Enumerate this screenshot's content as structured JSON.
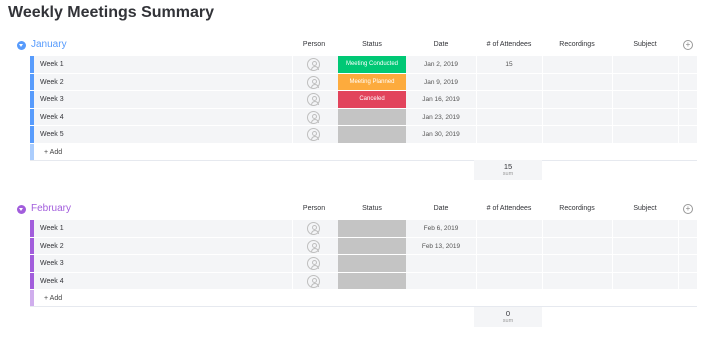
{
  "page_title": "Weekly Meetings Summary",
  "columns": {
    "person": "Person",
    "status": "Status",
    "date": "Date",
    "attendees": "# of Attendees",
    "recordings": "Recordings",
    "subject": "Subject"
  },
  "add_item_label": "+ Add",
  "sum_caption": "sum",
  "colors": {
    "january": "#579bfc",
    "february": "#a25ddc",
    "meeting_conducted": "#00c875",
    "meeting_planned": "#fdab3d",
    "canceled": "#e2445c",
    "empty_status": "#c4c4c4"
  },
  "groups": [
    {
      "title": "January",
      "sum": "15",
      "rows": [
        {
          "name": "Week 1",
          "status": "Meeting Conducted",
          "date": "Jan 2, 2019",
          "attendees": "15"
        },
        {
          "name": "Week 2",
          "status": "Meeting Planned",
          "date": "Jan 9, 2019",
          "attendees": ""
        },
        {
          "name": "Week 3",
          "status": "Canceled",
          "date": "Jan 16, 2019",
          "attendees": ""
        },
        {
          "name": "Week 4",
          "status": "",
          "date": "Jan 23, 2019",
          "attendees": ""
        },
        {
          "name": "Week 5",
          "status": "",
          "date": "Jan 30, 2019",
          "attendees": ""
        }
      ]
    },
    {
      "title": "February",
      "sum": "0",
      "rows": [
        {
          "name": "Week 1",
          "status": "",
          "date": "Feb 6, 2019",
          "attendees": ""
        },
        {
          "name": "Week 2",
          "status": "",
          "date": "Feb 13, 2019",
          "attendees": ""
        },
        {
          "name": "Week 3",
          "status": "",
          "date": "",
          "attendees": ""
        },
        {
          "name": "Week 4",
          "status": "",
          "date": "",
          "attendees": ""
        }
      ]
    }
  ]
}
